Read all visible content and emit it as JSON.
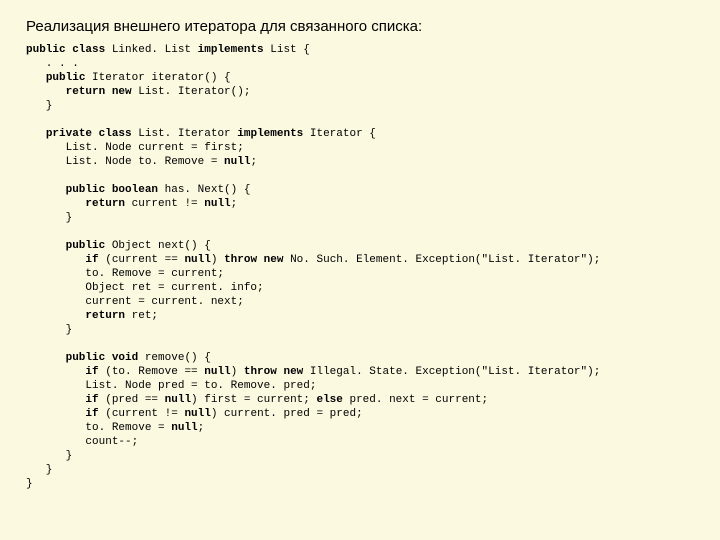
{
  "title": "Реализация внешнего итератора для связанного списка:",
  "code_tokens": [
    {
      "k": true,
      "t": "public class"
    },
    {
      "t": " Linked. List "
    },
    {
      "k": true,
      "t": "implements"
    },
    {
      "t": " List {\n"
    },
    {
      "t": "   . . .\n"
    },
    {
      "t": "   "
    },
    {
      "k": true,
      "t": "public"
    },
    {
      "t": " Iterator iterator() {\n"
    },
    {
      "t": "      "
    },
    {
      "k": true,
      "t": "return new"
    },
    {
      "t": " List. Iterator();\n"
    },
    {
      "t": "   }\n"
    },
    {
      "t": "\n"
    },
    {
      "t": "   "
    },
    {
      "k": true,
      "t": "private class"
    },
    {
      "t": " List. Iterator "
    },
    {
      "k": true,
      "t": "implements"
    },
    {
      "t": " Iterator {\n"
    },
    {
      "t": "      List. Node current = first;\n"
    },
    {
      "t": "      List. Node to. Remove = "
    },
    {
      "k": true,
      "t": "null"
    },
    {
      "t": ";\n"
    },
    {
      "t": "\n"
    },
    {
      "t": "      "
    },
    {
      "k": true,
      "t": "public boolean"
    },
    {
      "t": " has. Next() {\n"
    },
    {
      "t": "         "
    },
    {
      "k": true,
      "t": "return"
    },
    {
      "t": " current != "
    },
    {
      "k": true,
      "t": "null"
    },
    {
      "t": ";\n"
    },
    {
      "t": "      }\n"
    },
    {
      "t": "\n"
    },
    {
      "t": "      "
    },
    {
      "k": true,
      "t": "public"
    },
    {
      "t": " Object next() {\n"
    },
    {
      "t": "         "
    },
    {
      "k": true,
      "t": "if"
    },
    {
      "t": " (current == "
    },
    {
      "k": true,
      "t": "null"
    },
    {
      "t": ") "
    },
    {
      "k": true,
      "t": "throw new"
    },
    {
      "t": " No. Such. Element. Exception(\"List. Iterator\");\n"
    },
    {
      "t": "         to. Remove = current;\n"
    },
    {
      "t": "         Object ret = current. info;\n"
    },
    {
      "t": "         current = current. next;\n"
    },
    {
      "t": "         "
    },
    {
      "k": true,
      "t": "return"
    },
    {
      "t": " ret;\n"
    },
    {
      "t": "      }\n"
    },
    {
      "t": "\n"
    },
    {
      "t": "      "
    },
    {
      "k": true,
      "t": "public void"
    },
    {
      "t": " remove() {\n"
    },
    {
      "t": "         "
    },
    {
      "k": true,
      "t": "if"
    },
    {
      "t": " (to. Remove == "
    },
    {
      "k": true,
      "t": "null"
    },
    {
      "t": ") "
    },
    {
      "k": true,
      "t": "throw new"
    },
    {
      "t": " Illegal. State. Exception(\"List. Iterator\");\n"
    },
    {
      "t": "         List. Node pred = to. Remove. pred;\n"
    },
    {
      "t": "         "
    },
    {
      "k": true,
      "t": "if"
    },
    {
      "t": " (pred == "
    },
    {
      "k": true,
      "t": "null"
    },
    {
      "t": ") first = current; "
    },
    {
      "k": true,
      "t": "else"
    },
    {
      "t": " pred. next = current;\n"
    },
    {
      "t": "         "
    },
    {
      "k": true,
      "t": "if"
    },
    {
      "t": " (current != "
    },
    {
      "k": true,
      "t": "null"
    },
    {
      "t": ") current. pred = pred;\n"
    },
    {
      "t": "         to. Remove = "
    },
    {
      "k": true,
      "t": "null"
    },
    {
      "t": ";\n"
    },
    {
      "t": "         count--;\n"
    },
    {
      "t": "      }\n"
    },
    {
      "t": "   }\n"
    },
    {
      "t": "}"
    }
  ]
}
